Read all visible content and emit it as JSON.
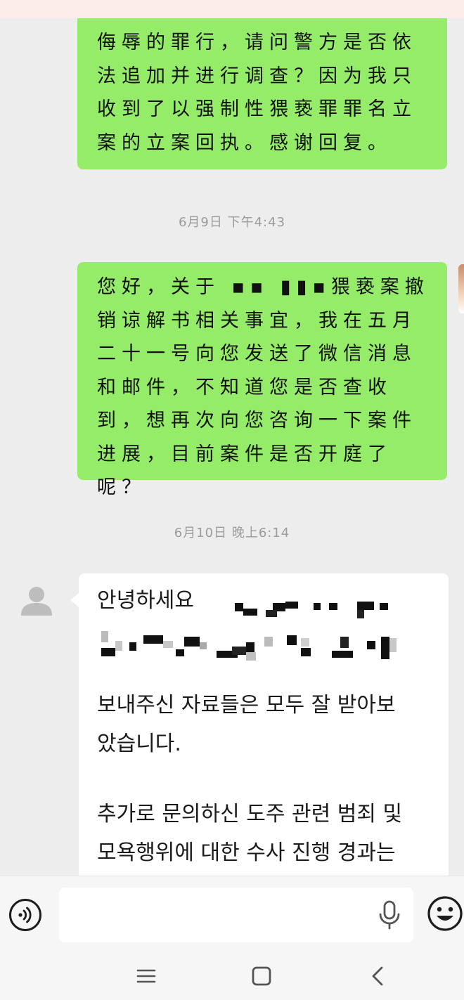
{
  "messages": [
    {
      "type": "sent",
      "text": "侮辱的罪行，请问警方是否依法追加并进行调查？因为我只收到了以强制性猥亵罪罪名立案的立案回执。感谢回复。"
    },
    {
      "type": "time",
      "text": "6月9日  下午4:43"
    },
    {
      "type": "sent",
      "text": "您好，关于 ▪▪  ▮▮▪猥亵案撤销谅解书相关事宜，我在五月二十一号向您发送了微信消息和邮件，不知道您是否查收到，想再次向您咨询一下案件进展，目前案件是否开庭了呢？"
    },
    {
      "type": "time",
      "text": "6月10日  晚上6:14"
    },
    {
      "type": "received",
      "lines": [
        "안녕하세요",
        "보내주신 자료들은 모두 잘 받아보",
        "았습니다.",
        "추가로 문의하신 도주 관련 범죄 및",
        "모욕행위에 대한 수사 진행 경과는"
      ]
    }
  ],
  "input_bar": {
    "voice_icon": "voice-input-icon",
    "placeholder": "",
    "mic_icon": "microphone-icon",
    "emoji_icon": "emoji-icon"
  },
  "nav_bar": {
    "menu_icon": "menu-icon",
    "home_icon": "home-icon",
    "back_icon": "back-icon"
  },
  "colors": {
    "sent_bubble": "#95ec69",
    "received_bubble": "#ffffff",
    "chat_background": "#ededed",
    "timestamp_text": "#9b9b9b"
  }
}
